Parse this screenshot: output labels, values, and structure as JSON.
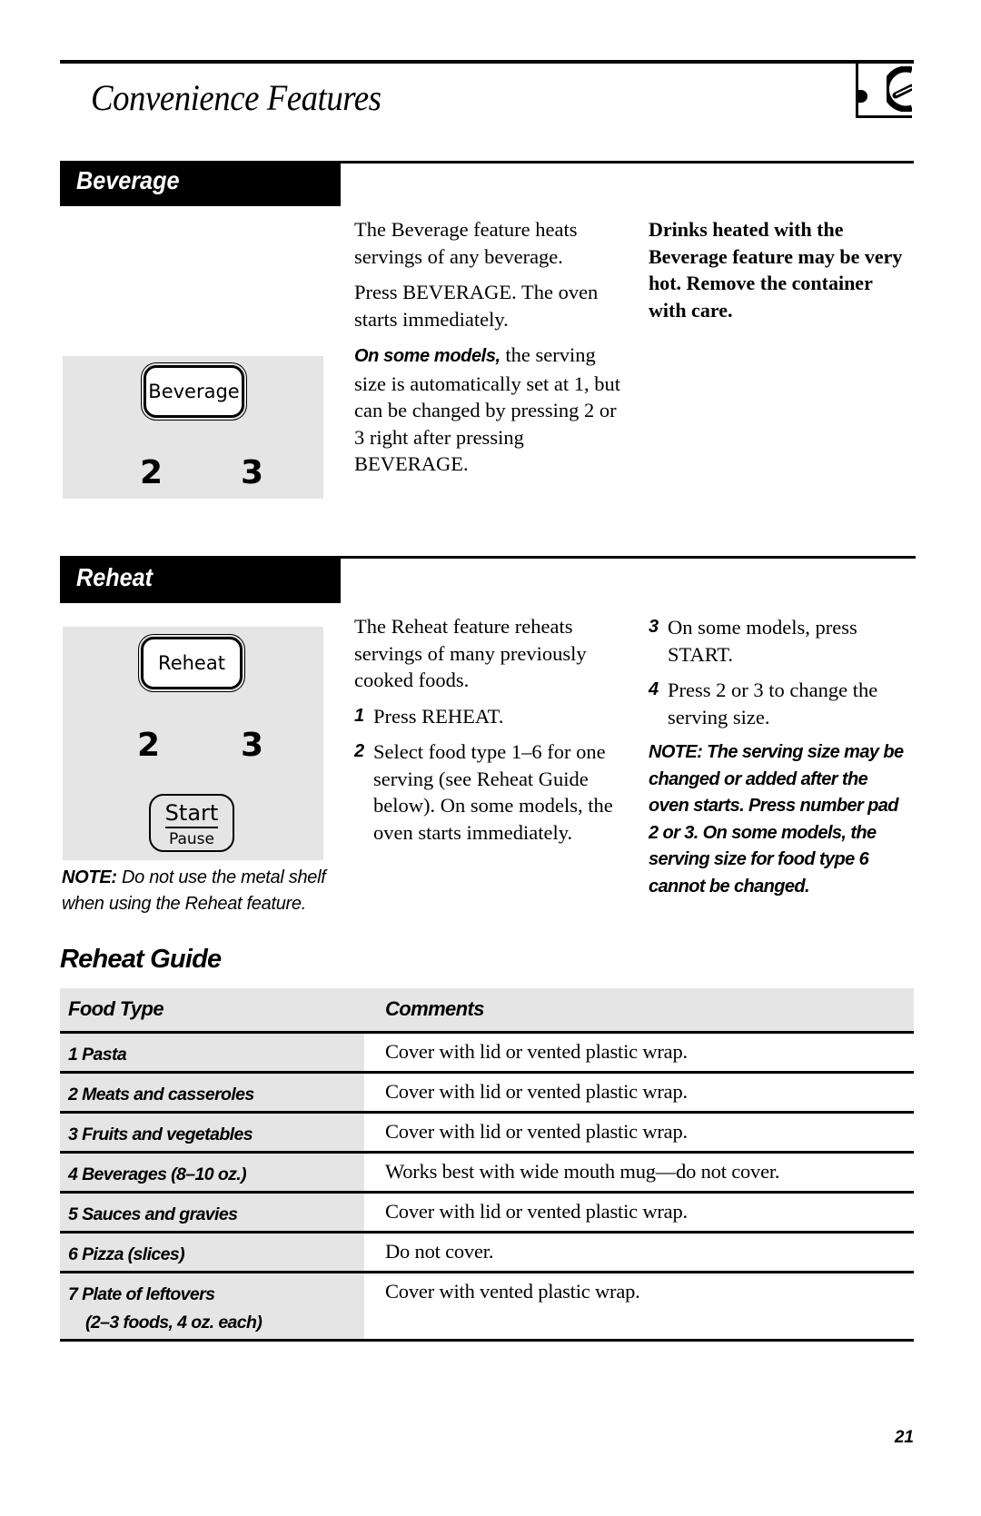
{
  "header": {
    "title": "Convenience Features",
    "logo_icon": "microwave-dial-icon"
  },
  "beverage": {
    "heading": "Beverage",
    "panel": {
      "key_label": "Beverage",
      "digit_left": "2",
      "digit_right": "3"
    },
    "paragraphs": [
      "The Beverage feature heats servings of any beverage.",
      "Press BEVERAGE. The oven starts immediately."
    ],
    "models_lead": "On some models,",
    "models_text": " the serving size is automatically set at 1, but can be changed by pressing 2 or 3 right after pressing BEVERAGE.",
    "warning": "Drinks heated with the Beverage feature may be very hot. Remove the container with care."
  },
  "reheat": {
    "heading": "Reheat",
    "panel": {
      "key_label": "Reheat",
      "digit_left": "2",
      "digit_right": "3",
      "start_label": "Start",
      "pause_label": "Pause"
    },
    "note_lead": "NOTE:",
    "note_text": " Do not use the metal shelf when using the Reheat feature.",
    "intro": "The Reheat feature reheats servings of many previously cooked foods.",
    "steps": [
      {
        "num": "1",
        "text": "Press REHEAT."
      },
      {
        "num": "2",
        "text": "Select food type 1–6 for one serving (see Reheat Guide below). On some models, the oven starts immediately."
      },
      {
        "num": "3",
        "text": "On some models, press START."
      },
      {
        "num": "4",
        "text": "Press 2 or 3 to change the serving size."
      }
    ],
    "serving_note": "NOTE: The serving size may be changed or added after the oven starts. Press number pad 2 or 3. On some models, the serving size for food type 6 cannot be changed."
  },
  "guide": {
    "title": "Reheat Guide",
    "columns": [
      "Food Type",
      "Comments"
    ],
    "rows": [
      {
        "food": "1 Pasta",
        "sub": "",
        "comment": "Cover with lid or vented plastic wrap."
      },
      {
        "food": "2 Meats and casseroles",
        "sub": "",
        "comment": "Cover with lid or vented plastic wrap."
      },
      {
        "food": "3 Fruits and vegetables",
        "sub": "",
        "comment": "Cover with lid or vented plastic wrap."
      },
      {
        "food": "4 Beverages (8–10 oz.)",
        "sub": "",
        "comment": "Works best with wide mouth mug—do not cover."
      },
      {
        "food": "5 Sauces and gravies",
        "sub": "",
        "comment": "Cover with lid or vented plastic wrap."
      },
      {
        "food": "6 Pizza (slices)",
        "sub": "",
        "comment": "Do not cover."
      },
      {
        "food": "7 Plate of leftovers",
        "sub": "(2–3 foods, 4 oz. each)",
        "comment": "Cover with vented plastic wrap."
      }
    ]
  },
  "footer": {
    "page_number": "21"
  }
}
